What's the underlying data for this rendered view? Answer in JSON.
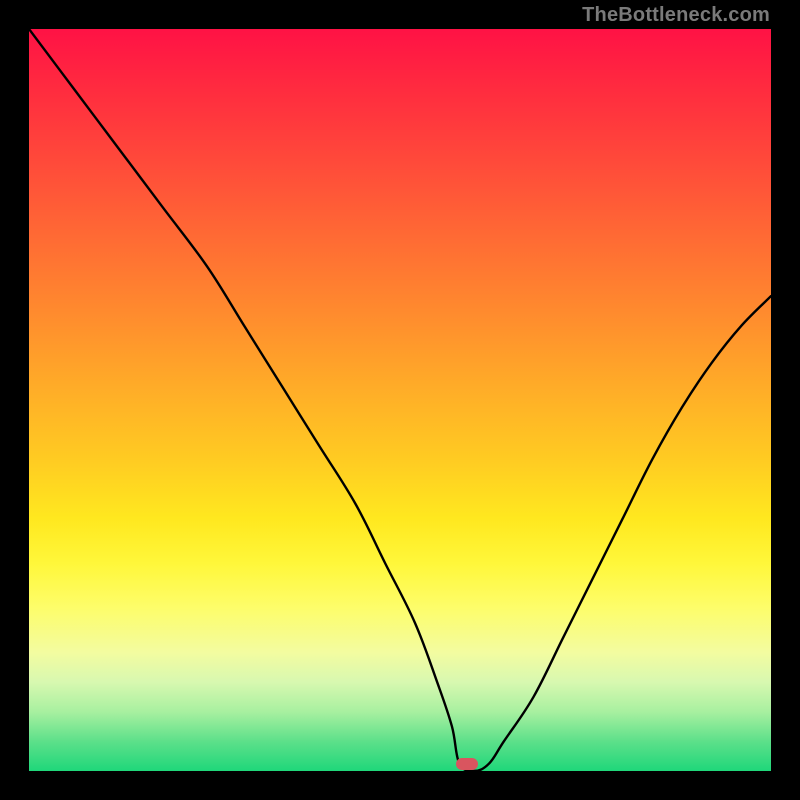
{
  "watermark": "TheBottleneck.com",
  "colors": {
    "frame": "#000000",
    "curve_stroke": "#000000",
    "marker_fill": "#d9555f"
  },
  "chart_data": {
    "type": "line",
    "title": "",
    "xlabel": "",
    "ylabel": "",
    "xlim": [
      0,
      100
    ],
    "ylim": [
      0,
      100
    ],
    "grid": false,
    "legend": false,
    "series": [
      {
        "name": "bottleneck-curve",
        "x": [
          0,
          6,
          12,
          18,
          24,
          29,
          34,
          39,
          44,
          48,
          52,
          55,
          57,
          58,
          60,
          62,
          64,
          68,
          72,
          76,
          80,
          84,
          88,
          92,
          96,
          100
        ],
        "values": [
          100,
          92,
          84,
          76,
          68,
          60,
          52,
          44,
          36,
          28,
          20,
          12,
          6,
          1,
          0,
          1,
          4,
          10,
          18,
          26,
          34,
          42,
          49,
          55,
          60,
          64
        ]
      }
    ],
    "annotations": [
      {
        "name": "minimum-marker",
        "x": 59,
        "y": 1
      }
    ]
  }
}
